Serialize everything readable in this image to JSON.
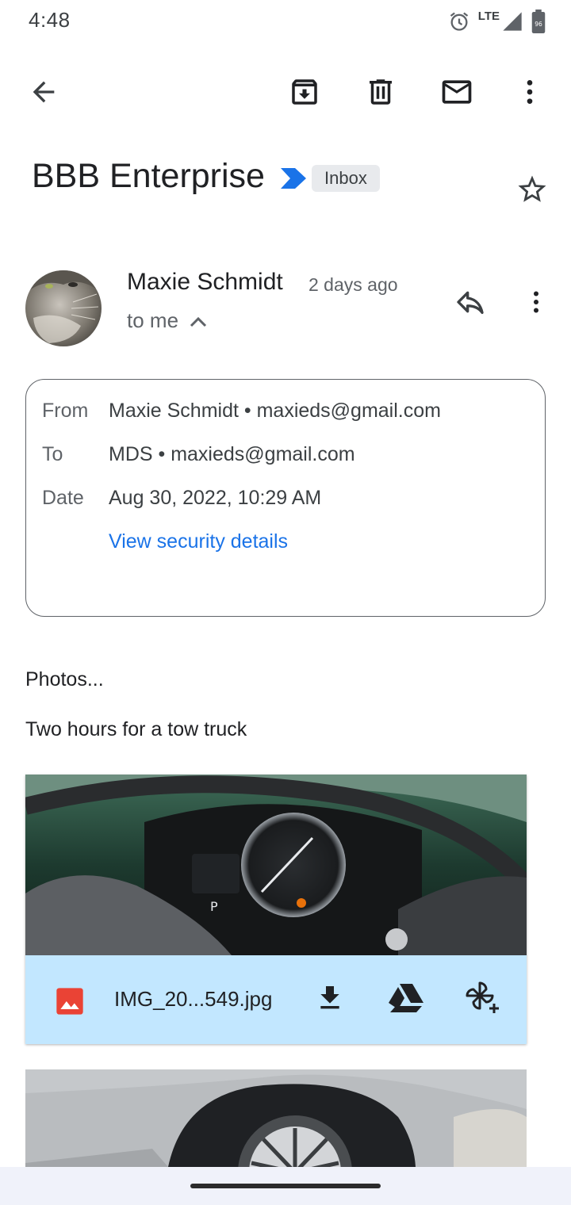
{
  "status_bar": {
    "time": "4:48",
    "network": "LTE",
    "icons": [
      "alarm-icon",
      "signal-icon",
      "battery-icon"
    ]
  },
  "toolbar": {
    "icons": [
      "back-arrow-icon",
      "archive-icon",
      "delete-icon",
      "mark-unread-icon",
      "more-vert-icon"
    ]
  },
  "email": {
    "subject": "BBB Enterprise",
    "label": "Inbox",
    "sender": {
      "name": "Maxie Schmidt",
      "time": "2 days ago",
      "recipient_summary": "to me"
    },
    "details": {
      "from_label": "From",
      "from_value": "Maxie Schmidt • maxieds@gmail.com",
      "to_label": "To",
      "to_value": "MDS • maxieds@gmail.com",
      "date_label": "Date",
      "date_value": "Aug 30, 2022, 10:29 AM",
      "security_link": "View security details"
    },
    "body": {
      "line1": "Photos...",
      "line2": "Two hours for a tow truck"
    },
    "attachments": [
      {
        "filename": "IMG_20...549.jpg",
        "actions": [
          "download-icon",
          "google-drive-icon",
          "add-to-photos-icon"
        ]
      }
    ]
  },
  "colors": {
    "accent": "#1a73e8",
    "attachment_bar": "#c2e7ff",
    "importance_marker": "#1a73e8",
    "image_icon": "#ea4335"
  }
}
